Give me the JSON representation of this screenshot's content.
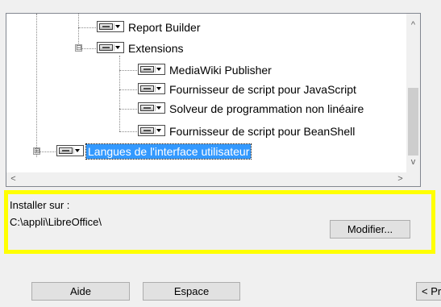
{
  "tree": {
    "items": [
      {
        "label": "Report Builder"
      },
      {
        "label": "Extensions",
        "expander": "⊟"
      },
      {
        "label": "MediaWiki Publisher"
      },
      {
        "label": "Fournisseur de script pour JavaScript"
      },
      {
        "label": "Solveur de programmation non linéaire"
      },
      {
        "label": "Fournisseur de script pour BeanShell"
      },
      {
        "label": "Langues de l'interface utilisateur",
        "expander": "⊞"
      }
    ],
    "scroll_up": "^",
    "scroll_down": "v",
    "scroll_left": "<",
    "scroll_right": ">"
  },
  "install": {
    "label": "Installer sur :",
    "path": "C:\\appli\\LibreOffice\\",
    "modify_button": "Modifier..."
  },
  "footer": {
    "help_button": "Aide",
    "space_button": "Espace",
    "prev_button": "< Pr"
  },
  "colors": {
    "highlight": "#ffff00",
    "selection": "#3399ff"
  }
}
